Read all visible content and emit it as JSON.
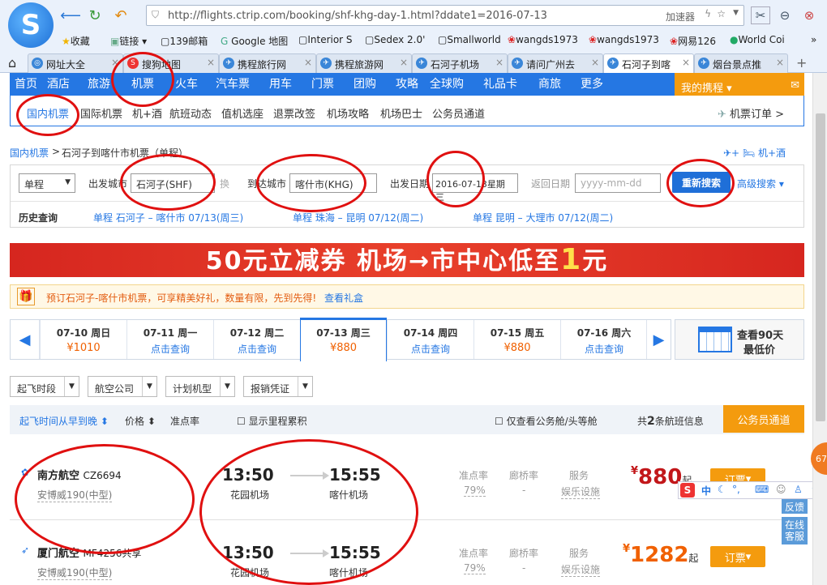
{
  "browser": {
    "url": "http://flights.ctrip.com/booking/shf-khg-day-1.html?ddate1=2016-07-13",
    "accelerator": "加速器",
    "bookmarks": [
      "收藏",
      "链接",
      "139邮箱",
      "Google 地图",
      "Interior S",
      "Sedex 2.0'",
      "Smallworld",
      "wangds1973",
      "wangds1973",
      "网易126",
      "World Coi"
    ],
    "tabs": [
      "网址大全",
      "搜狗地图",
      "携程旅行网",
      "携程旅游网",
      "石河子机场",
      "请问广州去",
      "石河子到喀",
      "烟台景点推"
    ]
  },
  "site_nav": {
    "items": [
      "首页",
      "酒店",
      "旅游",
      "机票",
      "火车",
      "汽车票",
      "用车",
      "门票",
      "团购",
      "攻略",
      "全球购",
      "礼品卡",
      "商旅",
      "更多"
    ],
    "my_ctrip": "我的携程",
    "sub_items": [
      "国内机票",
      "国际机票",
      "机+酒",
      "航班动态",
      "值机选座",
      "退票改签",
      "机场攻略",
      "机场巴士",
      "公务员通道"
    ],
    "order": "机票订单 >"
  },
  "breadcrumb": {
    "root": "国内机票",
    "current": "石河子到喀什市机票（单程）",
    "combo": "机+酒"
  },
  "search": {
    "trip_type": "单程",
    "from_label": "出发城市",
    "from_value": "石河子(SHF)",
    "swap": "换",
    "to_label": "到达城市",
    "to_value": "喀什市(KHG)",
    "date_label": "出发日期",
    "date_value": "2016-07-13星期三",
    "return_label": "返回日期",
    "return_placeholder": "yyyy-mm-dd",
    "search_button": "重新搜索",
    "advanced": "高级搜索",
    "history_label": "历史查询",
    "history": [
      "单程 石河子 – 喀什市 07/13(周三)",
      "单程 珠海 – 昆明 07/12(周二)",
      "单程 昆明 – 大理市 07/12(周二)"
    ]
  },
  "banner": {
    "prefix": "50元立减券 机场→市中心低至",
    "one": "1",
    "suffix": "元"
  },
  "gift": {
    "text": "预订石河子-喀什市机票，可享精美好礼，数量有限，先到先得!",
    "link": "查看礼盒"
  },
  "dates": [
    {
      "date": "07-10 周日",
      "price": "¥1010"
    },
    {
      "date": "07-11 周一",
      "price": "点击查询"
    },
    {
      "date": "07-12 周二",
      "price": "点击查询"
    },
    {
      "date": "07-13 周三",
      "price": "¥880"
    },
    {
      "date": "07-14 周四",
      "price": "点击查询"
    },
    {
      "date": "07-15 周五",
      "price": "¥880"
    },
    {
      "date": "07-16 周六",
      "price": "点击查询"
    }
  ],
  "lowest": {
    "line1": "查看90天",
    "line2": "最低价"
  },
  "filters": [
    "起飞时段",
    "航空公司",
    "计划机型",
    "报销凭证"
  ],
  "sortbar": {
    "sort_time": "起飞时间从早到晚",
    "sort_price": "价格",
    "ontime": "准点率",
    "mileage": "显示里程累积",
    "business": "仅查看公务舱/头等舱",
    "count_prefix": "共",
    "count": "2",
    "count_suffix": "条航班信息",
    "gov_button": "公务员通道"
  },
  "flights": [
    {
      "airline": "南方航空",
      "code": "CZ6694",
      "plane": "安博威190(中型)",
      "dep": "13:50",
      "dep_apt": "花园机场",
      "arr": "15:55",
      "arr_apt": "喀什机场",
      "ontime_label": "准点率",
      "ontime": "79%",
      "bridge_label": "廊桥率",
      "bridge": "-",
      "service_label": "服务",
      "service": "娱乐设施",
      "price": "880",
      "price_suffix": "起",
      "book": "订票"
    },
    {
      "airline": "厦门航空",
      "code": "MF4256共享",
      "plane": "安博威190(中型)",
      "dep": "13:50",
      "dep_apt": "花园机场",
      "arr": "15:55",
      "arr_apt": "喀什机场",
      "ontime_label": "准点率",
      "ontime": "79%",
      "bridge_label": "廊桥率",
      "bridge": "-",
      "service_label": "服务",
      "service": "娱乐设施",
      "price": "1282",
      "price_suffix": "起",
      "book": "订票"
    }
  ],
  "side": {
    "feedback": "反馈",
    "online": "在线客服",
    "bubble": "67"
  },
  "ime": "中",
  "colors": {
    "ctrip_blue": "#2577e3",
    "orange": "#f49b0e",
    "annotation_red": "#e01010",
    "price_red": "#c2171a"
  }
}
